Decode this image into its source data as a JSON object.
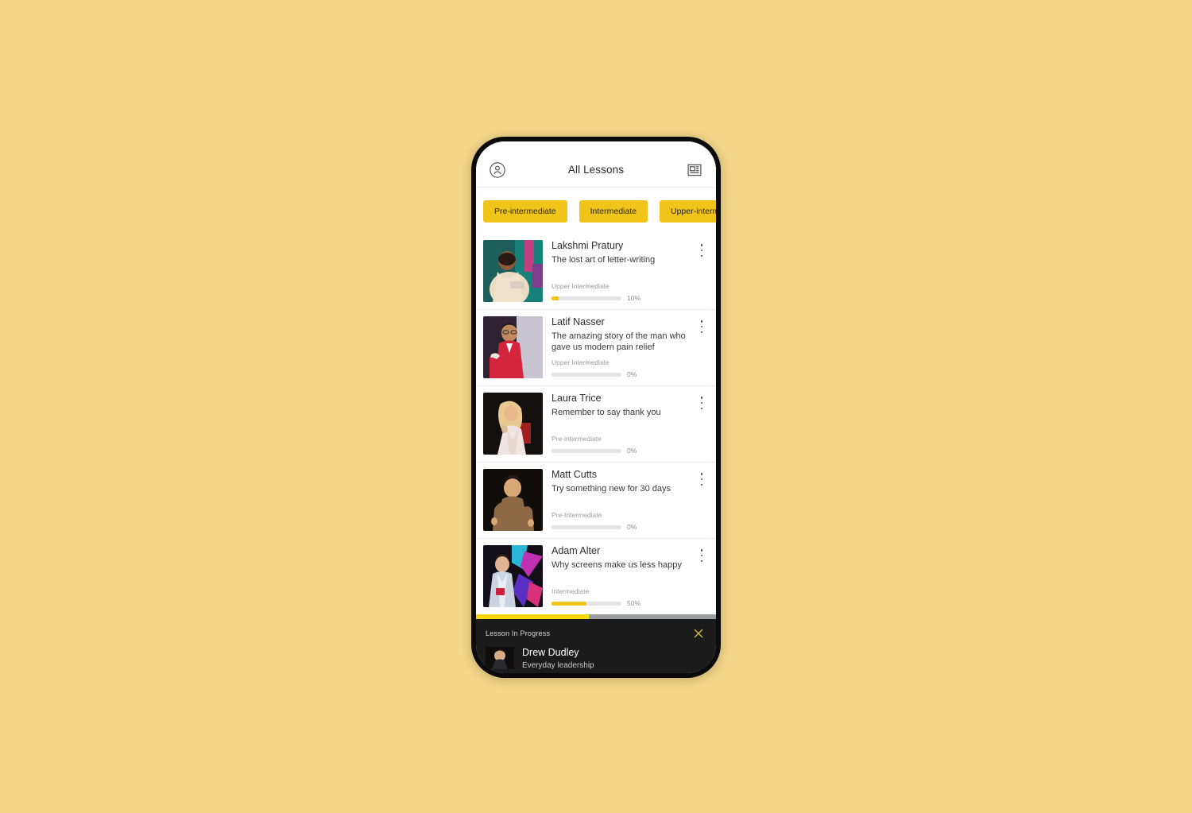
{
  "page": {
    "background_color": "#f3d68a",
    "accent_color": "#f0c419"
  },
  "header": {
    "title": "All Lessons",
    "profile_icon": "profile-circle-icon",
    "articles_icon": "article-card-icon"
  },
  "filters": {
    "chips": [
      {
        "label": "Pre-intermediate"
      },
      {
        "label": "Intermediate"
      },
      {
        "label": "Upper-intermediate"
      }
    ]
  },
  "lessons": [
    {
      "speaker": "Lakshmi Pratury",
      "title": "The lost art of letter-writing",
      "level": "Upper Intermediate",
      "progress": 10,
      "progress_label": "10%"
    },
    {
      "speaker": "Latif Nasser",
      "title": "The amazing story of the man who gave us modern pain relief",
      "level": "Upper Intermediate",
      "progress": 0,
      "progress_label": "0%"
    },
    {
      "speaker": "Laura Trice",
      "title": "Remember to say thank you",
      "level": "Pre-intermediate",
      "progress": 0,
      "progress_label": "0%"
    },
    {
      "speaker": "Matt Cutts",
      "title": "Try something new for 30 days",
      "level": "Pre-Intermediate",
      "progress": 0,
      "progress_label": "0%"
    },
    {
      "speaker": "Adam Alter",
      "title": "Why screens make us less happy",
      "level": "Intermediate",
      "progress": 50,
      "progress_label": "50%"
    }
  ],
  "scroll_indicator": {
    "filled_percent": 47
  },
  "mini_player": {
    "label": "Lesson In Progress",
    "speaker": "Drew Dudley",
    "title": "Everyday leadership",
    "close_icon": "close-x-icon"
  }
}
